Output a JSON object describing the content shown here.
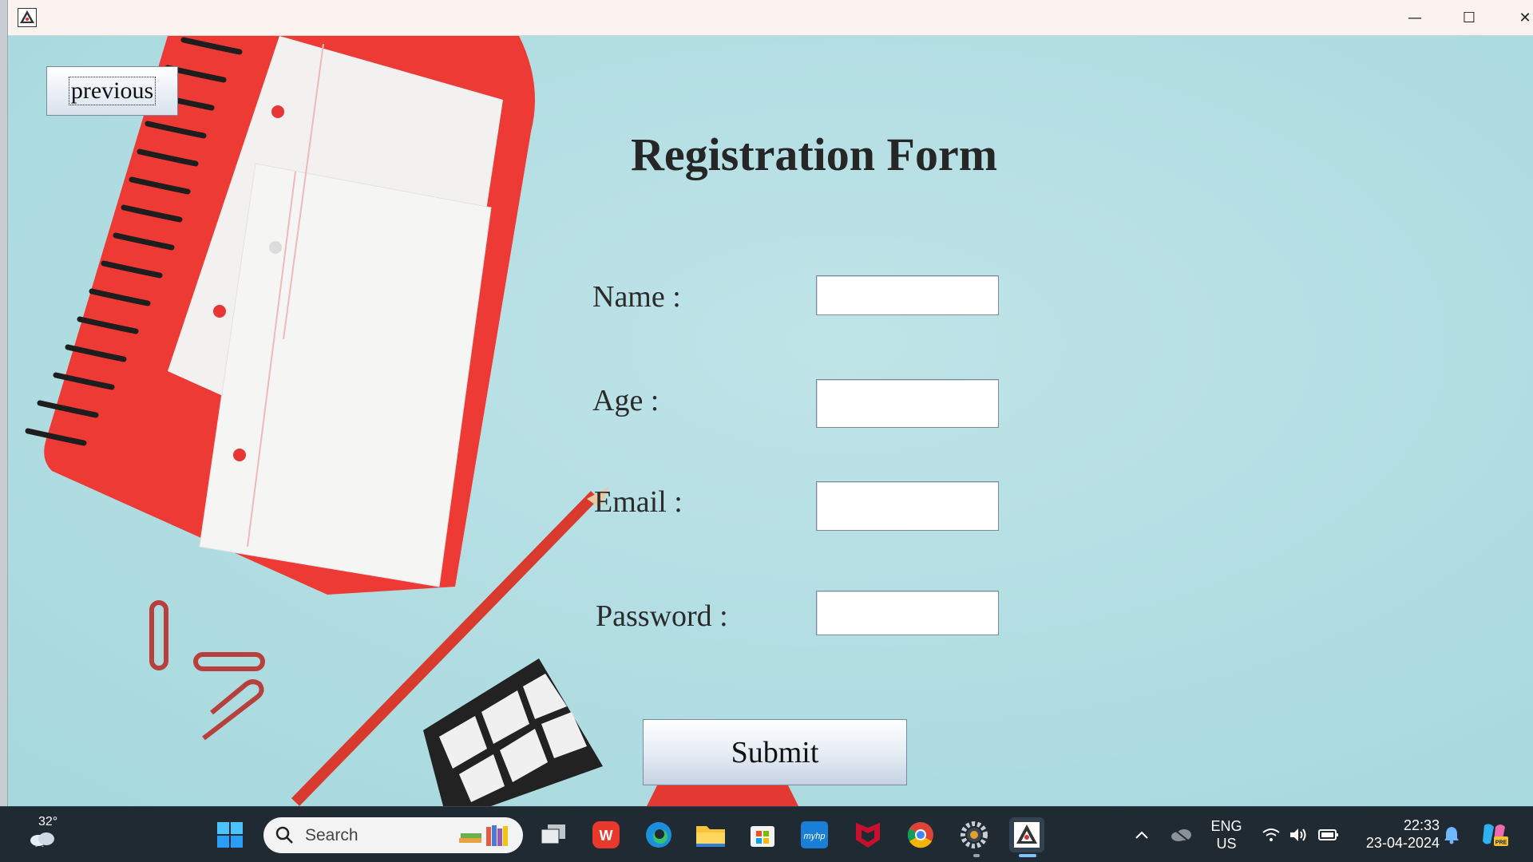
{
  "window": {
    "controls": {
      "minimize": "—",
      "maximize": "☐",
      "close": "✕"
    }
  },
  "form": {
    "previous_label": "previous",
    "title": "Registration Form",
    "fields": [
      {
        "label": "Name :",
        "value": ""
      },
      {
        "label": "Age :",
        "value": ""
      },
      {
        "label": "Email :",
        "value": ""
      },
      {
        "label": "Password :",
        "value": ""
      }
    ],
    "submit_label": "Submit"
  },
  "taskbar": {
    "weather_temp": "32°",
    "search_placeholder": "Search",
    "icons": [
      "start-icon",
      "task-view-icon",
      "wps-office-icon",
      "edge-icon",
      "file-explorer-icon",
      "microsoft-store-icon",
      "myhp-icon",
      "mcafee-icon",
      "chrome-icon",
      "settings-gear-icon",
      "java-app-icon"
    ],
    "tray": {
      "language_line1": "ENG",
      "language_line2": "US",
      "time": "22:33",
      "date": "23-04-2024"
    }
  },
  "colors": {
    "background": "#b2dfe3",
    "taskbar": "#1f2a33",
    "titlebar": "#faf3ef",
    "notebook_red": "#ee3a35"
  }
}
